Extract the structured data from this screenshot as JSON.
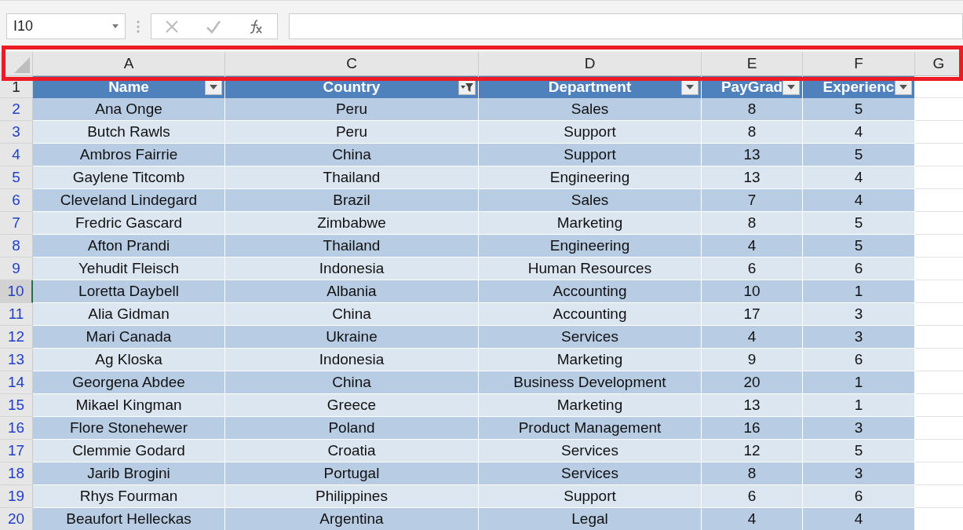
{
  "name_box": {
    "value": "I10"
  },
  "column_headers": [
    {
      "label": "A"
    },
    {
      "label": "C"
    },
    {
      "label": "D"
    },
    {
      "label": "E"
    },
    {
      "label": "F"
    },
    {
      "label": "G"
    }
  ],
  "highlight_frame": true,
  "table": {
    "header_row": "1",
    "columns": [
      {
        "label": "Name",
        "filtered": false
      },
      {
        "label": "Country",
        "filtered": true
      },
      {
        "label": "Department",
        "filtered": false
      },
      {
        "label": "PayGrad",
        "filtered": false
      },
      {
        "label": "Experienc",
        "filtered": false
      }
    ],
    "rows": [
      {
        "row": "2",
        "selected": false,
        "cells": [
          "Ana Onge",
          "Peru",
          "Sales",
          "8",
          "5"
        ]
      },
      {
        "row": "3",
        "selected": false,
        "cells": [
          "Butch Rawls",
          "Peru",
          "Support",
          "8",
          "4"
        ]
      },
      {
        "row": "4",
        "selected": false,
        "cells": [
          "Ambros Fairrie",
          "China",
          "Support",
          "13",
          "5"
        ]
      },
      {
        "row": "5",
        "selected": false,
        "cells": [
          "Gaylene Titcomb",
          "Thailand",
          "Engineering",
          "13",
          "4"
        ]
      },
      {
        "row": "6",
        "selected": false,
        "cells": [
          "Cleveland Lindegard",
          "Brazil",
          "Sales",
          "7",
          "4"
        ]
      },
      {
        "row": "7",
        "selected": false,
        "cells": [
          "Fredric Gascard",
          "Zimbabwe",
          "Marketing",
          "8",
          "5"
        ]
      },
      {
        "row": "8",
        "selected": false,
        "cells": [
          "Afton Prandi",
          "Thailand",
          "Engineering",
          "4",
          "5"
        ]
      },
      {
        "row": "9",
        "selected": false,
        "cells": [
          "Yehudit Fleisch",
          "Indonesia",
          "Human Resources",
          "6",
          "6"
        ]
      },
      {
        "row": "10",
        "selected": true,
        "cells": [
          "Loretta Daybell",
          "Albania",
          "Accounting",
          "10",
          "1"
        ]
      },
      {
        "row": "11",
        "selected": false,
        "cells": [
          "Alia Gidman",
          "China",
          "Accounting",
          "17",
          "3"
        ]
      },
      {
        "row": "12",
        "selected": false,
        "cells": [
          "Mari Canada",
          "Ukraine",
          "Services",
          "4",
          "3"
        ]
      },
      {
        "row": "13",
        "selected": false,
        "cells": [
          "Ag Kloska",
          "Indonesia",
          "Marketing",
          "9",
          "6"
        ]
      },
      {
        "row": "14",
        "selected": false,
        "cells": [
          "Georgena Abdee",
          "China",
          "Business Development",
          "20",
          "1"
        ]
      },
      {
        "row": "15",
        "selected": false,
        "cells": [
          "Mikael Kingman",
          "Greece",
          "Marketing",
          "13",
          "1"
        ]
      },
      {
        "row": "16",
        "selected": false,
        "cells": [
          "Flore Stonehewer",
          "Poland",
          "Product Management",
          "16",
          "3"
        ]
      },
      {
        "row": "17",
        "selected": false,
        "cells": [
          "Clemmie Godard",
          "Croatia",
          "Services",
          "12",
          "5"
        ]
      },
      {
        "row": "18",
        "selected": false,
        "cells": [
          "Jarib Brogini",
          "Portugal",
          "Services",
          "8",
          "3"
        ]
      },
      {
        "row": "19",
        "selected": false,
        "cells": [
          "Rhys Fourman",
          "Philippines",
          "Support",
          "6",
          "6"
        ]
      },
      {
        "row": "20",
        "selected": false,
        "cells": [
          "Beaufort Helleckas",
          "Argentina",
          "Legal",
          "4",
          "4"
        ]
      }
    ]
  }
}
